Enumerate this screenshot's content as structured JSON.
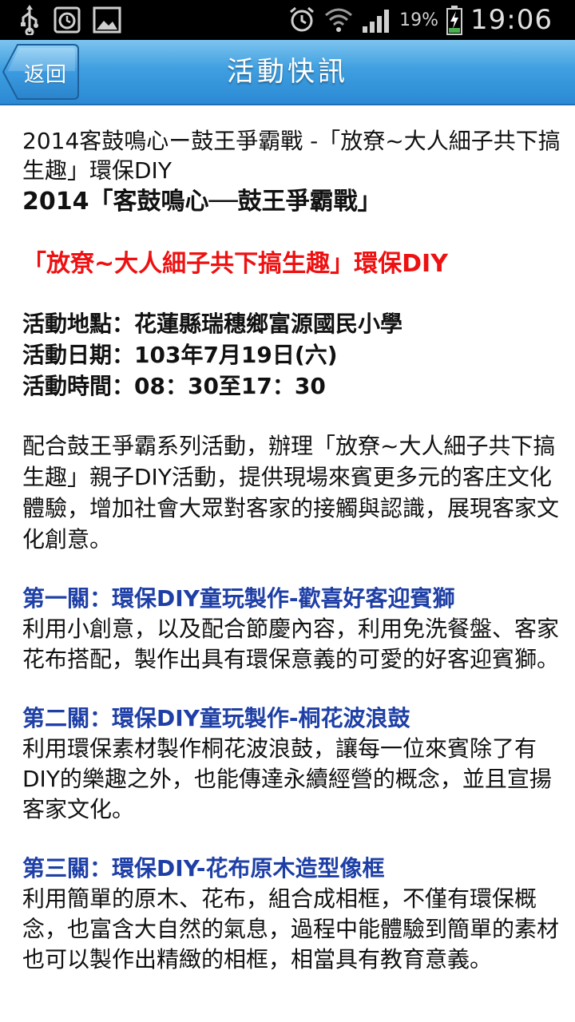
{
  "status_bar": {
    "battery_percent": "19%",
    "time": "19:06"
  },
  "header": {
    "back_label": "返回",
    "title": "活動快訊"
  },
  "article": {
    "heading": "2014客鼓鳴心ー鼓王爭霸戰 -「放尞~大人細子共下搞生趣」環保DIY",
    "event_title": "2014「客鼓鳴心──鼓王爭霸戰」",
    "event_subtitle": "「放尞~大人細子共下搞生趣」環保DIY",
    "location": "活動地點：花蓮縣瑞穗鄉富源國民小學",
    "date": "活動日期：103年7月19日(六)",
    "time": "活動時間：08：30至17：30",
    "intro": "配合鼓王爭霸系列活動，辦理「放尞~大人細子共下搞生趣」親子DIY活動，提供現場來賓更多元的客庄文化體驗，增加社會大眾對客家的接觸與認識，展現客家文化創意。",
    "stages": [
      {
        "title": "第一關：環保DIY童玩製作-歡喜好客迎賓獅",
        "description": "利用小創意，以及配合節慶內容，利用免洗餐盤、客家花布搭配，製作出具有環保意義的可愛的好客迎賓獅。"
      },
      {
        "title": "第二關：環保DIY童玩製作-桐花波浪鼓",
        "description": "利用環保素材製作桐花波浪鼓，讓每一位來賓除了有DIY的樂趣之外，也能傳達永續經營的概念，並且宣揚客家文化。"
      },
      {
        "title": "第三關：環保DIY-花布原木造型像框",
        "description": "利用簡單的原木、花布，組合成相框，不僅有環保概念，也富含大自然的氣息，過程中能體驗到簡單的素材也可以製作出精緻的相框，相當具有教育意義。"
      }
    ]
  },
  "colors": {
    "title_bar": "#3f9fe0",
    "subtitle_red": "#ee1111",
    "stage_blue": "#1e3fa6"
  }
}
